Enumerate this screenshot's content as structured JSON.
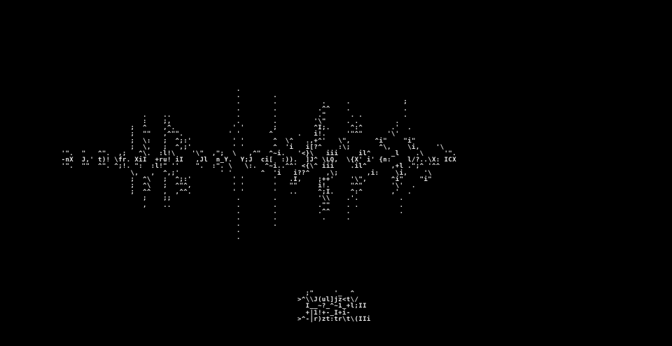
{
  "colors": {
    "background": "#000000",
    "text": "#e6e6e6"
  },
  "waveform_art": "                                             .                                                            \n                                             .        .                                                   \n                                             .        .           .     .             ;                   \n                                             .        .          .^^    .             .                   \n                      .    ..                .        .          .\"      . .          .                   \n                      :    ;,                .        .         '\\\"     . .         .                   \n                   ;  ^    ,^.              ' '       ;         ^I;.     ^:^       .'  .                   \n                   ;  \"\"   ,^\"\".           ' '       ^      .   i!.     '\"^\"      '\\'                   \n                   ;  \\:   ;  ^;:'          ' '       ^  \\^   .,+^'   \\\",      ^i\"    \"i\"                 \n                   ;  \\,   ;  ^,;'          ' '       ^  'i   i[?^    :\\;       ^\\,    \\i,    '\\        \n  '\".  \"   ^\".  ,;   ^\\.  :l!\\    '\\\"  ,\";  \\   ,^\"  ^~i.   '<}\\   iii     il^     _l    .\\     '\".  \n  -nX  J,' t)! \\fr. XiI  +ru! iI   ,Jl  n_Y.  Y;J  ci[  :)).  ]J^ \\LQ,  \\{X' i' {n:    l/?..\\X: ICX  \n  '\".  \"\"  ^\". ^;!. \":  :l!\" ''    \".  :\". \\   \\:.  ^~i..^^' <{\\^ iii    .il^      ,+l .\";^ '^^  \n                   \\,   ,  ^,;'          ' '       ^  'i   i??^    ,\\;       ,i:    \\i,    '\\        \n                   ;  ^\\   ;  ^;:'          ' '       '   .I,    ;++'    '\\\",      ^i\"    \"i\"        \n                   ;  ^\\   ;  ^\"^,          ' '       '   \"\"     i!.     \"^\"       '\\'  .                \n                   ;  ^^   ,  ,^^.          ' '       '   ..     ^;I.    ^:^       ,'  .                \n                      ;    ;;                .        .          '\\\\    .'.          .                   \n                      ,    ..                .        .          .\"\"    . .          .                   \n                                             .        .          .^^    .            .                   \n                                             .        .           .     .                                \n                                             .        .                                                  \n                                             .                                                           \n                                             .                                                           ",
  "logo_art": "  ;\"     '_  ^\n>^\\\\J(ul]jz<t\\/\n  I__~?_^~1_+l;II\n  +|1!+-_I+i-\n>^-|r)zt:tr\\t\\(IIi"
}
